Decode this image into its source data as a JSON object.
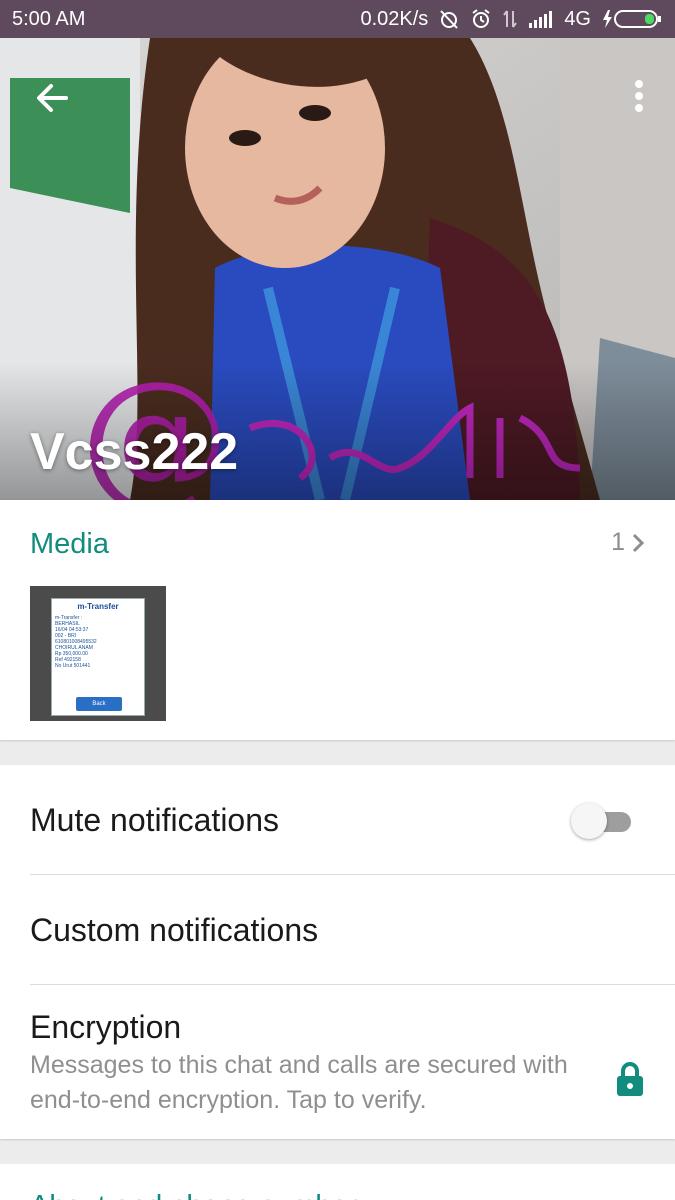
{
  "status_bar": {
    "time": "5:00 AM",
    "speed": "0.02K/s",
    "network": "4G",
    "icons": [
      "alarm-off-icon",
      "alarm-clock-icon",
      "data-transfer-icon",
      "signal-icon",
      "battery-charging-icon"
    ]
  },
  "header": {
    "contact_name": "Vcss222",
    "back_icon": "arrow-left-icon",
    "menu_icon": "more-vert-icon"
  },
  "media": {
    "title": "Media",
    "count": "1",
    "thumbnail": {
      "window_title": "m-Transfer",
      "lines": "m-Transfer :\nBERHASIL\n16/04 04:53:37\n002 - BRI\n610801008495532\nCHOIRUL ANAM\nRp 350,000.00\nRef 492158\nNo Urut 501441",
      "button": "Back"
    }
  },
  "settings": {
    "mute_label": "Mute notifications",
    "mute_on": false,
    "custom_label": "Custom notifications",
    "encryption_label": "Encryption",
    "encryption_desc": "Messages to this chat and calls are secured with end-to-end encryption. Tap to verify."
  },
  "about": {
    "title": "About and phone number"
  },
  "colors": {
    "accent": "#128c7e",
    "status_bar": "#5e4a5c"
  }
}
